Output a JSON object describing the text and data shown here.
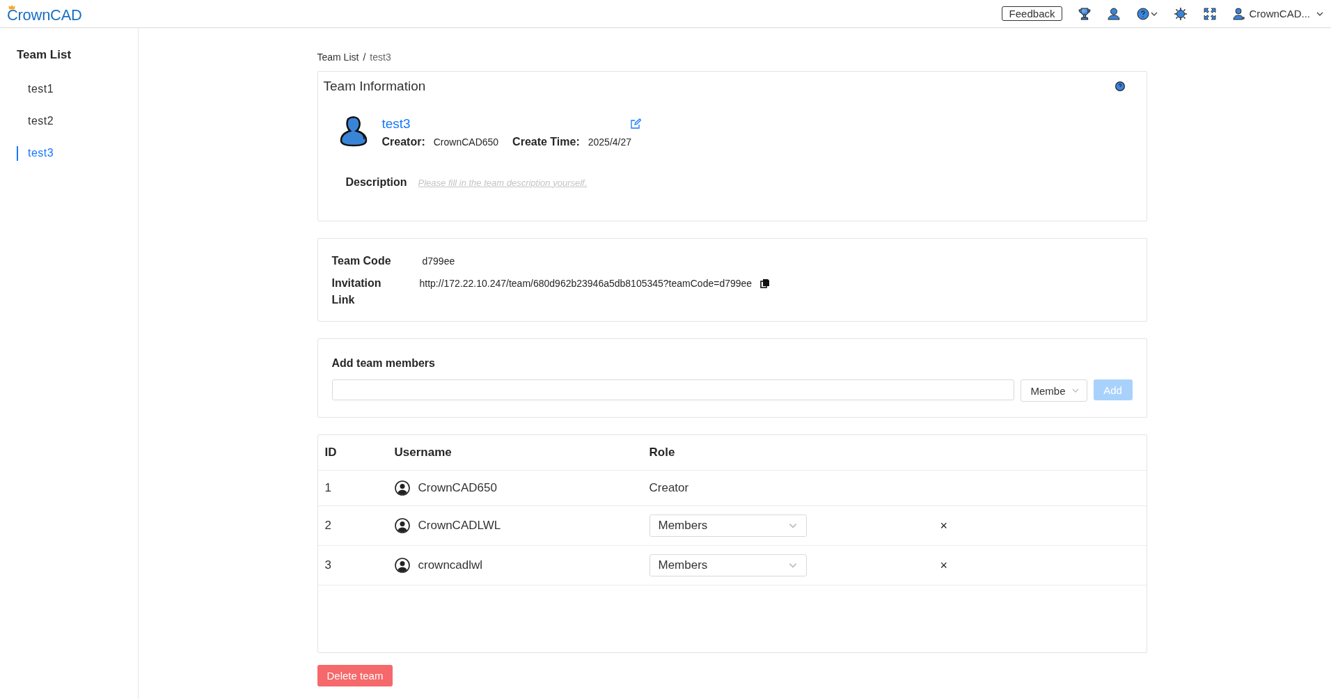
{
  "header": {
    "logo": "CrownCAD",
    "feedback": "Feedback",
    "user": "CrownCAD..."
  },
  "sidebar": {
    "title": "Team List",
    "items": [
      {
        "label": "test1",
        "selected": false
      },
      {
        "label": "test2",
        "selected": false
      },
      {
        "label": "test3",
        "selected": true
      }
    ]
  },
  "breadcrumb": {
    "items": [
      "Team List",
      "test3"
    ],
    "separator": "/"
  },
  "team_info": {
    "title": "Team Information",
    "name": "test3",
    "creator_label": "Creator:",
    "creator": "CrownCAD650",
    "create_time_label": "Create Time:",
    "create_time": "2025/4/27",
    "description_label": "Description",
    "description_placeholder": "Please fill in the team description yourself."
  },
  "team_code": {
    "code_label": "Team Code",
    "code": "d799ee",
    "link_label": "Invitation Link",
    "link": "http://172.22.10.247/team/680d962b23946a5db8105345?teamCode=d799ee"
  },
  "add_members": {
    "title": "Add team members",
    "role": "Membe",
    "button": "Add",
    "disabled": true
  },
  "table": {
    "columns": [
      "ID",
      "Username",
      "Role"
    ],
    "rows": [
      {
        "id": "1",
        "username": "CrownCAD650",
        "kind": "text",
        "role": "Creator"
      },
      {
        "id": "2",
        "username": "CrownCADLWL",
        "kind": "select",
        "role": "Members",
        "remove": "×"
      },
      {
        "id": "3",
        "username": "crowncadlwl",
        "kind": "select",
        "role": "Members",
        "remove": "×"
      }
    ]
  },
  "delete_button": "Delete team"
}
